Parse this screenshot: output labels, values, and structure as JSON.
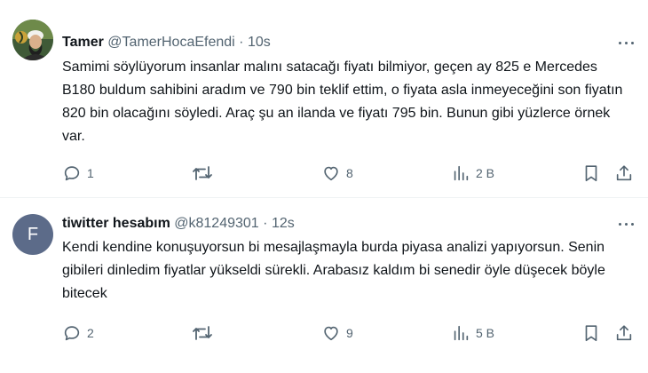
{
  "tweets": [
    {
      "name": "Tamer",
      "handle": "@TamerHocaEfendi",
      "separator": "·",
      "time": "10s",
      "text": "Samimi söylüyorum insanlar malını satacağı fiyatı bilmiyor, geçen ay 825 e Mercedes B180 buldum sahibini aradım ve 790 bin teklif ettim, o fiyata asla inmeyeceğini son fiyatın 820 bin olacağını söyledi. Araç şu an ilanda ve fiyatı 795 bin. Bunun gibi yüzlerce örnek var.",
      "replies": "1",
      "likes": "8",
      "views": "2 B"
    },
    {
      "name": "tiwitter hesabım",
      "handle": "@k81249301",
      "separator": "·",
      "time": "12s",
      "avatar_letter": "F",
      "text": "Kendi kendine konuşuyorsun bi mesajlaşmayla burda piyasa analizi yapıyorsun. Senin gibileri dinledim fiyatlar yükseldi sürekli. Arabasız kaldım bi senedir öyle düşecek böyle bitecek",
      "replies": "2",
      "likes": "9",
      "views": "5 B"
    }
  ],
  "colors": {
    "text": "#0f1419",
    "muted": "#536471",
    "divider": "#eff3f4",
    "avatar_letter_bg": "#5c6b89"
  }
}
